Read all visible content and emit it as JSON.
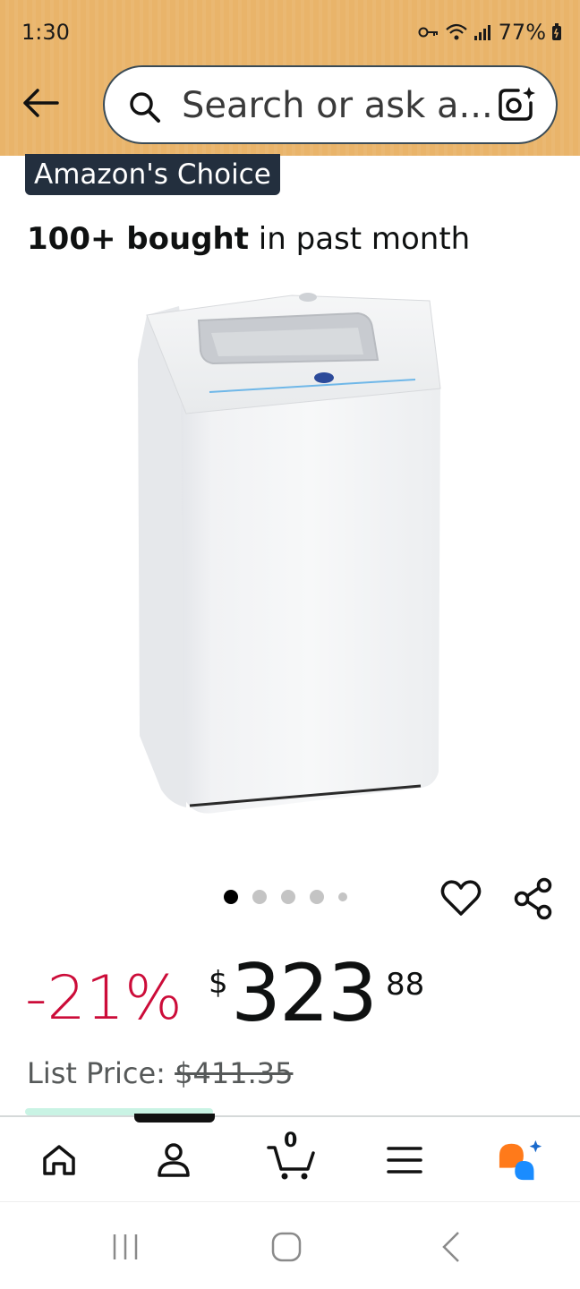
{
  "status_bar": {
    "time": "1:30",
    "battery": "77%"
  },
  "header": {
    "search": {
      "placeholder": "Search or ask a..."
    }
  },
  "product": {
    "badge": "Amazon's Choice",
    "bought_bold": "100+ bought",
    "bought_rest": " in past month",
    "image_count": 5,
    "active_image": 1,
    "price": {
      "discount": "-21%",
      "currency": "$",
      "whole": "323",
      "fraction": "88"
    },
    "list_price_label": "List Price: ",
    "list_price_value": "$411.35"
  },
  "bottom_nav": {
    "cart_count": "0",
    "items": [
      "home-icon",
      "account-icon",
      "cart-icon",
      "menu-icon",
      "rufus-icon"
    ]
  },
  "colors": {
    "header_bg": "#ebb46d",
    "discount": "#cc0c39",
    "badge_bg": "#232f3e",
    "rufus_orange": "#ff7a1a",
    "rufus_blue": "#1a8cff"
  }
}
